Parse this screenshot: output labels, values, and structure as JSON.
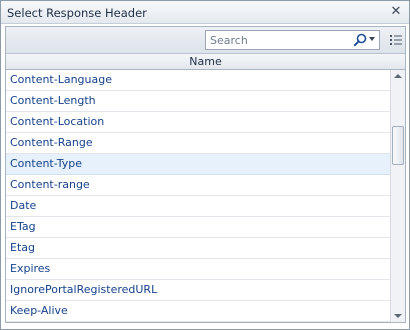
{
  "window": {
    "title": "Select Response Header",
    "close_glyph": "✕"
  },
  "toolbar": {
    "search": {
      "placeholder": "Search",
      "value": ""
    },
    "icons": [
      "search-icon",
      "chevron-down-icon",
      "list-menu-icon"
    ]
  },
  "table": {
    "column_header": "Name",
    "rows": [
      {
        "label": "Content-Language",
        "selected": false
      },
      {
        "label": "Content-Length",
        "selected": false
      },
      {
        "label": "Content-Location",
        "selected": false
      },
      {
        "label": "Content-Range",
        "selected": false
      },
      {
        "label": "Content-Type",
        "selected": true
      },
      {
        "label": "Content-range",
        "selected": false
      },
      {
        "label": "Date",
        "selected": false
      },
      {
        "label": "ETag",
        "selected": false
      },
      {
        "label": "Etag",
        "selected": false
      },
      {
        "label": "Expires",
        "selected": false
      },
      {
        "label": "IgnorePortalRegisteredURL",
        "selected": false
      },
      {
        "label": "Keep-Alive",
        "selected": false
      }
    ]
  },
  "colors": {
    "text": "#15428b",
    "selected_row": "#e6f1fb",
    "border": "#a9b4c1"
  }
}
